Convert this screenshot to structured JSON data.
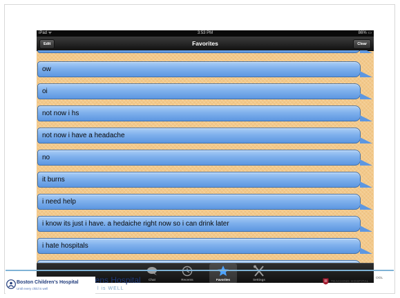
{
  "statusbar": {
    "carrier": "iPad ᯤ",
    "time": "3:53 PM",
    "battery": "86% ▭"
  },
  "navbar": {
    "title": "Favorites",
    "edit_label": "Edit",
    "clear_label": "Clear"
  },
  "favorites": [
    {
      "text": "ow"
    },
    {
      "text": "oi"
    },
    {
      "text": "not now i hs"
    },
    {
      "text": "not now i have  a headache"
    },
    {
      "text": "no"
    },
    {
      "text": "it burns"
    },
    {
      "text": "i need help"
    },
    {
      "text": "i know its just i have. a hedaiche right now so i can drink later"
    },
    {
      "text": "i hate hospitals"
    }
  ],
  "tabs": [
    {
      "label": "Chat",
      "icon": "chat-bubble-icon",
      "active": false
    },
    {
      "label": "Recents",
      "icon": "clock-icon",
      "active": false
    },
    {
      "label": "Favorites",
      "icon": "star-icon",
      "active": true
    },
    {
      "label": "Settings",
      "icon": "tools-icon",
      "active": false
    }
  ],
  "footer": {
    "hospital_name": "Boston Children's Hospital",
    "hospital_tagline": "Until every child is well",
    "behind_text": "drens Hospital",
    "behind_sub": "l is WELL",
    "right_logo_text": "TEACHING HOSPITAL",
    "edge_text": "OOL"
  },
  "colors": {
    "bubble_blue": "#7fb0ec",
    "wallpaper": "#f3c98a",
    "bar_dark": "#121212",
    "accent_line": "#7fb3d6",
    "brand_navy": "#1e3a7b"
  }
}
